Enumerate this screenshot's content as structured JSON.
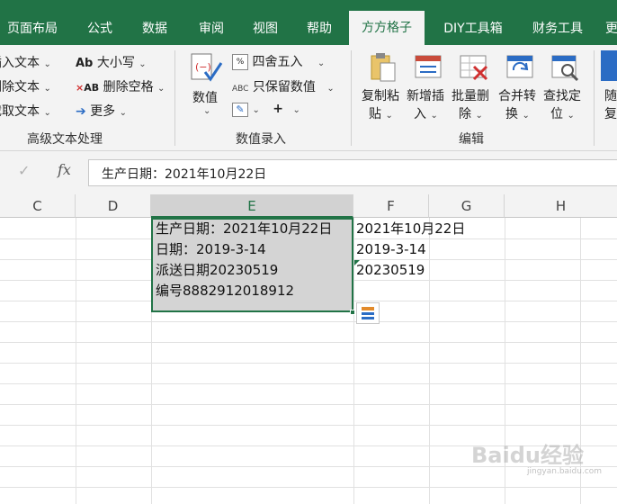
{
  "tabs": [
    {
      "label": "页面布局"
    },
    {
      "label": "公式"
    },
    {
      "label": "数据"
    },
    {
      "label": "审阅"
    },
    {
      "label": "视图"
    },
    {
      "label": "帮助"
    },
    {
      "label": "方方格子"
    },
    {
      "label": "DIY工具箱"
    },
    {
      "label": "财务工具"
    },
    {
      "label": "更"
    }
  ],
  "active_tab": "方方格子",
  "ribbon": {
    "text_group": {
      "insert_text": "插入文本",
      "delete_text": "删除文本",
      "extract_text": "截取文本",
      "case": "大小写",
      "delete_spaces": "删除空格",
      "more": "更多",
      "label": "高级文本处理"
    },
    "number_group": {
      "numeric": "数值",
      "round": "四舍五入",
      "keep_numeric": "只保留数值",
      "label": "数值录入"
    },
    "edit_group": {
      "copy_paste_1": "复制粘",
      "copy_paste_2": "贴",
      "new_insert_1": "新增插",
      "new_insert_2": "入",
      "batch_delete_1": "批量删",
      "batch_delete_2": "除",
      "merge_convert_1": "合并转",
      "merge_convert_2": "换",
      "find_locate_1": "查找定",
      "find_locate_2": "位",
      "label": "编辑"
    },
    "random_1": "随",
    "random_2": "复"
  },
  "formula_bar": {
    "content": "生产日期：2021年10月22日"
  },
  "columns": [
    "C",
    "D",
    "E",
    "F",
    "G",
    "H"
  ],
  "selected_column": "E",
  "cells": {
    "E1": "生产日期：2021年10月22日",
    "E2": "日期：2019-3-14",
    "E3": "派送日期20230519",
    "E4": "编号8882912018912",
    "F1": "2021年10月22日",
    "F2": "2019-3-14",
    "F3": "20230519"
  },
  "watermark": {
    "main": "Baidu经验",
    "sub": "jingyan.baidu.com"
  }
}
